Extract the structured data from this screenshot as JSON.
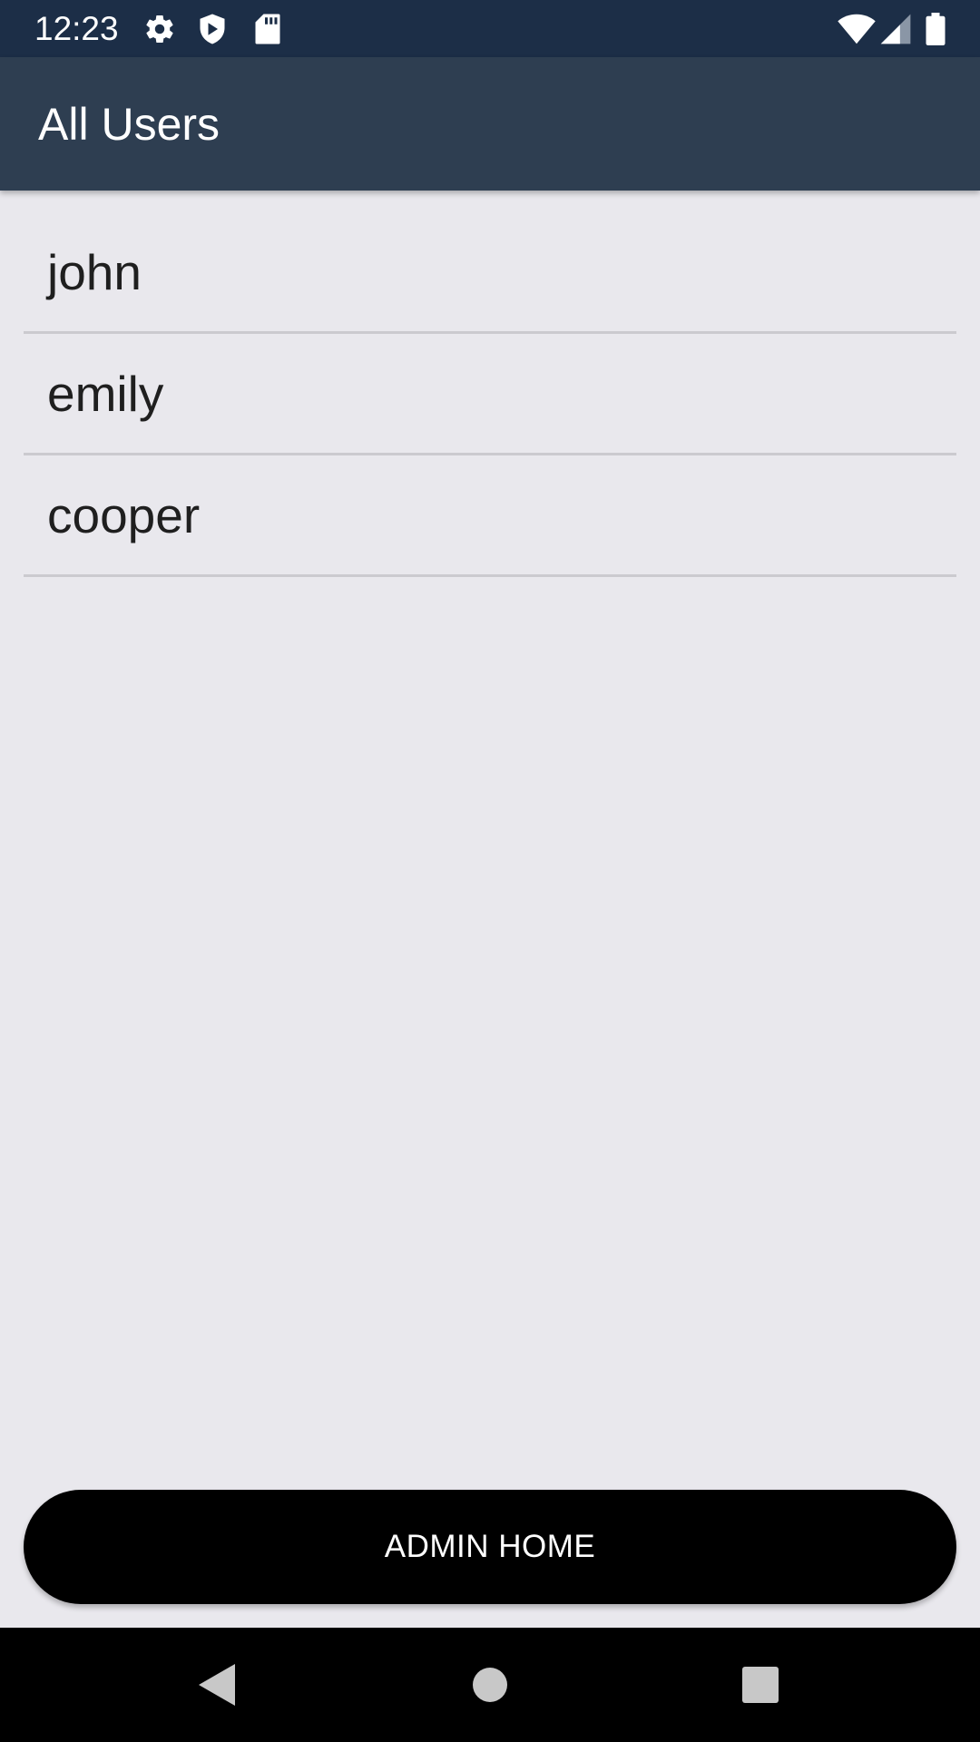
{
  "status_bar": {
    "time": "12:23",
    "left_icons": [
      "gear-icon",
      "shield-icon",
      "sd-card-icon"
    ],
    "right_icons": [
      "wifi-icon",
      "cell-signal-icon",
      "battery-icon"
    ]
  },
  "app_bar": {
    "title": "All Users"
  },
  "users": [
    {
      "name": "john"
    },
    {
      "name": "emily"
    },
    {
      "name": "cooper"
    }
  ],
  "admin_button": {
    "label": "ADMIN HOME"
  },
  "nav_bar": {
    "buttons": [
      "back-icon",
      "home-icon",
      "recents-icon"
    ]
  },
  "colors": {
    "status_bar": "#1C2E47",
    "app_bar": "#2E3E51",
    "background": "#E9E8ED",
    "divider": "#CBCACF",
    "button": "#000000",
    "nav_bar": "#000000"
  }
}
